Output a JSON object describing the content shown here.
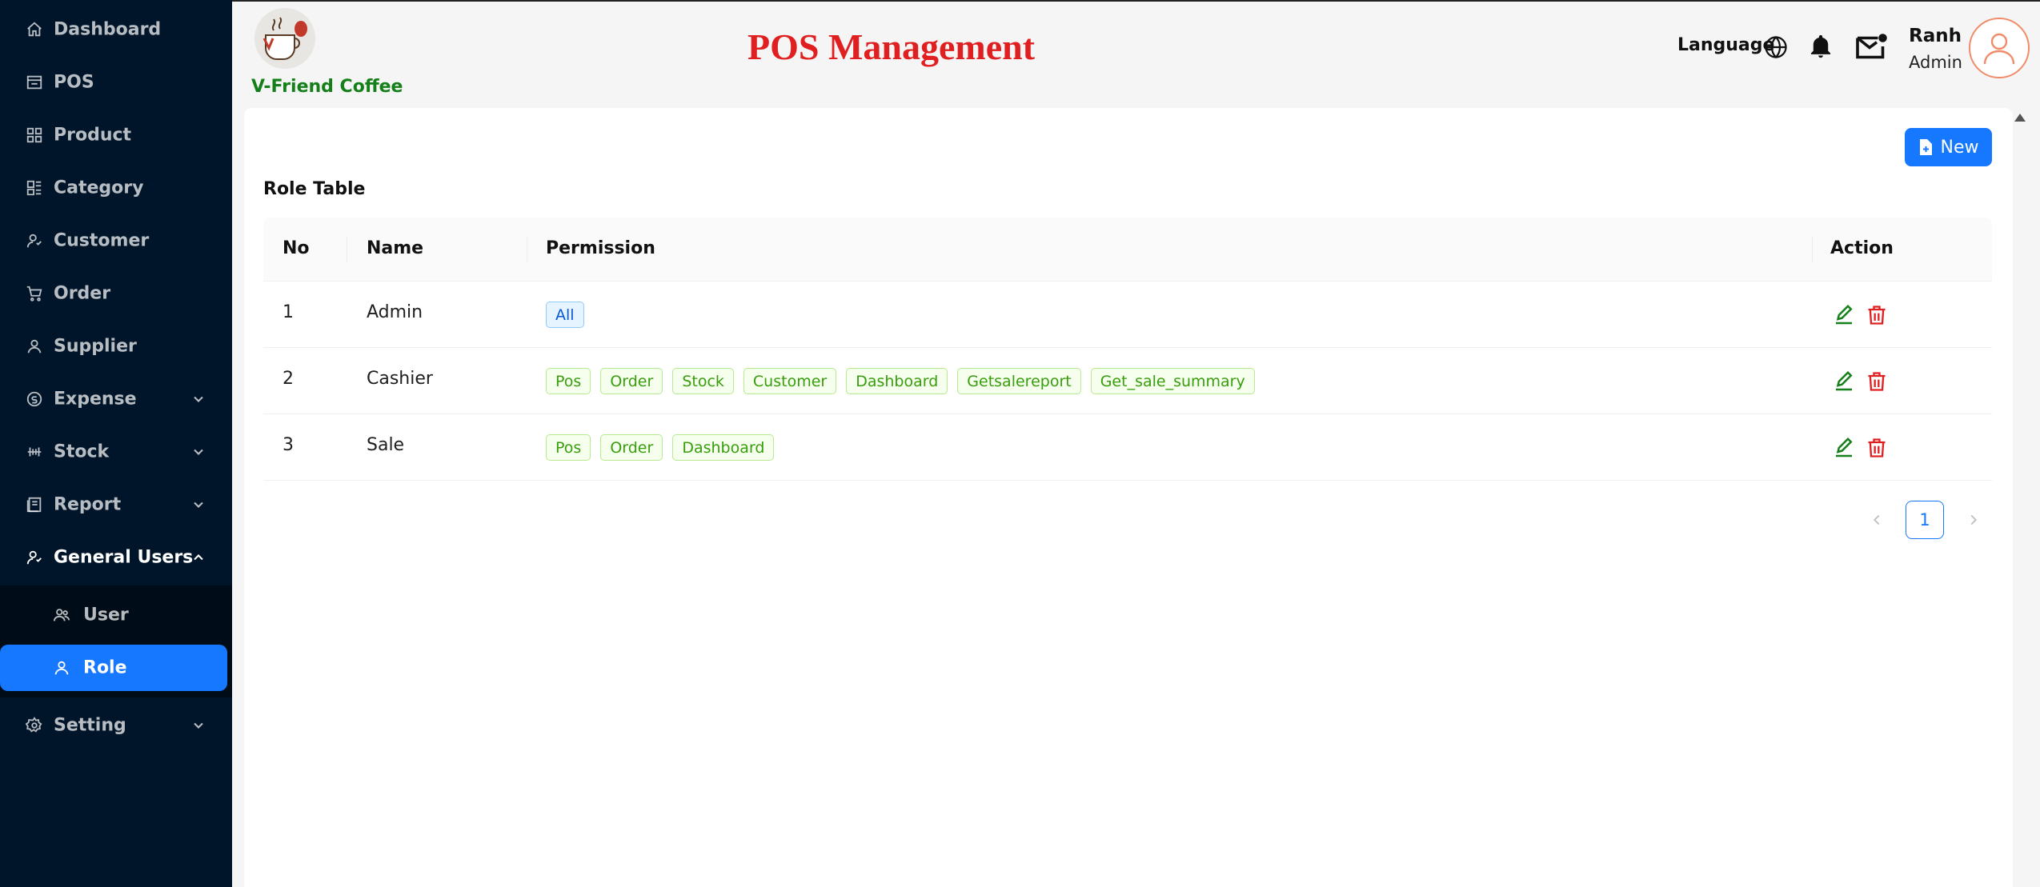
{
  "sidebar": {
    "items": [
      {
        "label": "Dashboard",
        "icon": "home-icon"
      },
      {
        "label": "POS",
        "icon": "store-icon"
      },
      {
        "label": "Product",
        "icon": "grid-icon"
      },
      {
        "label": "Category",
        "icon": "category-icon"
      },
      {
        "label": "Customer",
        "icon": "customer-icon"
      },
      {
        "label": "Order",
        "icon": "cart-icon"
      },
      {
        "label": "Supplier",
        "icon": "user-icon"
      },
      {
        "label": "Expense",
        "icon": "expense-icon"
      },
      {
        "label": "Stock",
        "icon": "stock-icon"
      },
      {
        "label": "Report",
        "icon": "report-icon"
      },
      {
        "label": "General Users",
        "icon": "users-icon"
      },
      {
        "label": "Setting",
        "icon": "gear-icon"
      }
    ],
    "sub_items": [
      {
        "label": "User",
        "icon": "team-icon"
      },
      {
        "label": "Role",
        "icon": "user-icon"
      }
    ]
  },
  "header": {
    "brand": "V-Friend Coffee",
    "title": "POS Management",
    "language_label": "Language",
    "user_name": "Ranh",
    "user_role": "Admin"
  },
  "content": {
    "new_button": "New",
    "table_title": "Role Table",
    "columns": [
      "No",
      "Name",
      "Permission",
      "Action"
    ],
    "rows": [
      {
        "no": "1",
        "name": "Admin",
        "permissions": [
          "All"
        ]
      },
      {
        "no": "2",
        "name": "Cashier",
        "permissions": [
          "Pos",
          "Order",
          "Stock",
          "Customer",
          "Dashboard",
          "Getsalereport",
          "Get_sale_summary"
        ]
      },
      {
        "no": "3",
        "name": "Sale",
        "permissions": [
          "Pos",
          "Order",
          "Dashboard"
        ]
      }
    ],
    "pagination": {
      "current": "1"
    }
  },
  "colors": {
    "sidebar_bg": "#001529",
    "accent": "#1677ff",
    "title_red": "#e02020",
    "brand_green": "#15801a",
    "delete_red": "#e02020",
    "edit_green": "#15801a"
  }
}
